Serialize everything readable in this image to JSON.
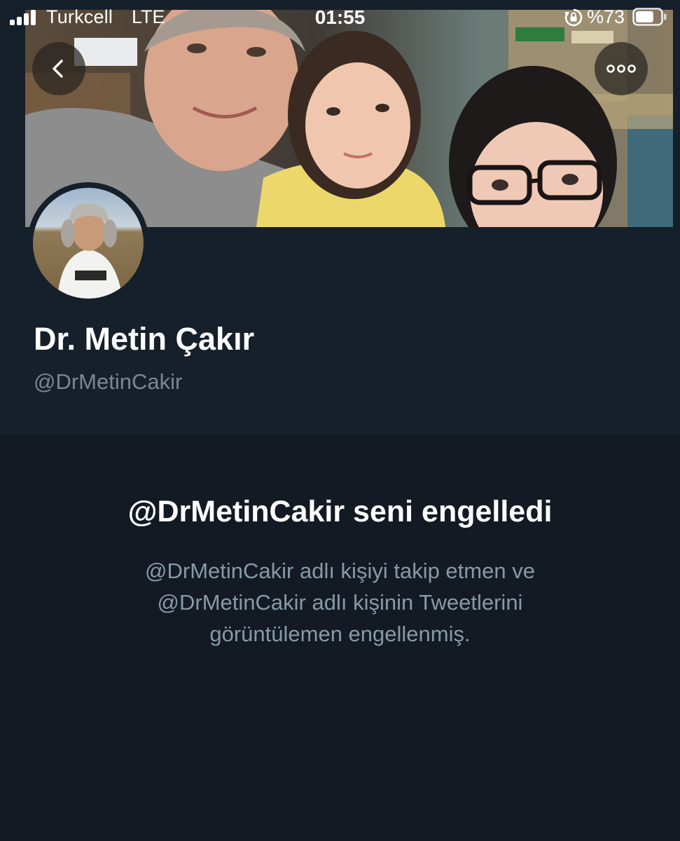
{
  "status_bar": {
    "carrier": "Turkcell",
    "network": "LTE",
    "time": "01:55",
    "battery_percent": "%73",
    "battery_level": 0.73,
    "icons": [
      "signal-icon",
      "rotation-lock-icon",
      "battery-icon"
    ]
  },
  "header": {
    "back_icon": "chevron-left-icon",
    "more_icon": "more-horizontal-icon"
  },
  "profile": {
    "display_name": "Dr. Metin Çakır",
    "handle": "@DrMetinCakir"
  },
  "blocked": {
    "title": "@DrMetinCakir seni engelledi",
    "lines": [
      "@DrMetinCakir adlı kişiyi takip etmen ve",
      "@DrMetinCakir adlı kişinin Tweetlerini",
      "görüntülemen engellenmiş."
    ]
  },
  "colors": {
    "background": "#15202b",
    "blocked_background": "#131a24",
    "primary_text": "#ffffff",
    "secondary_text": "#8899a6"
  }
}
